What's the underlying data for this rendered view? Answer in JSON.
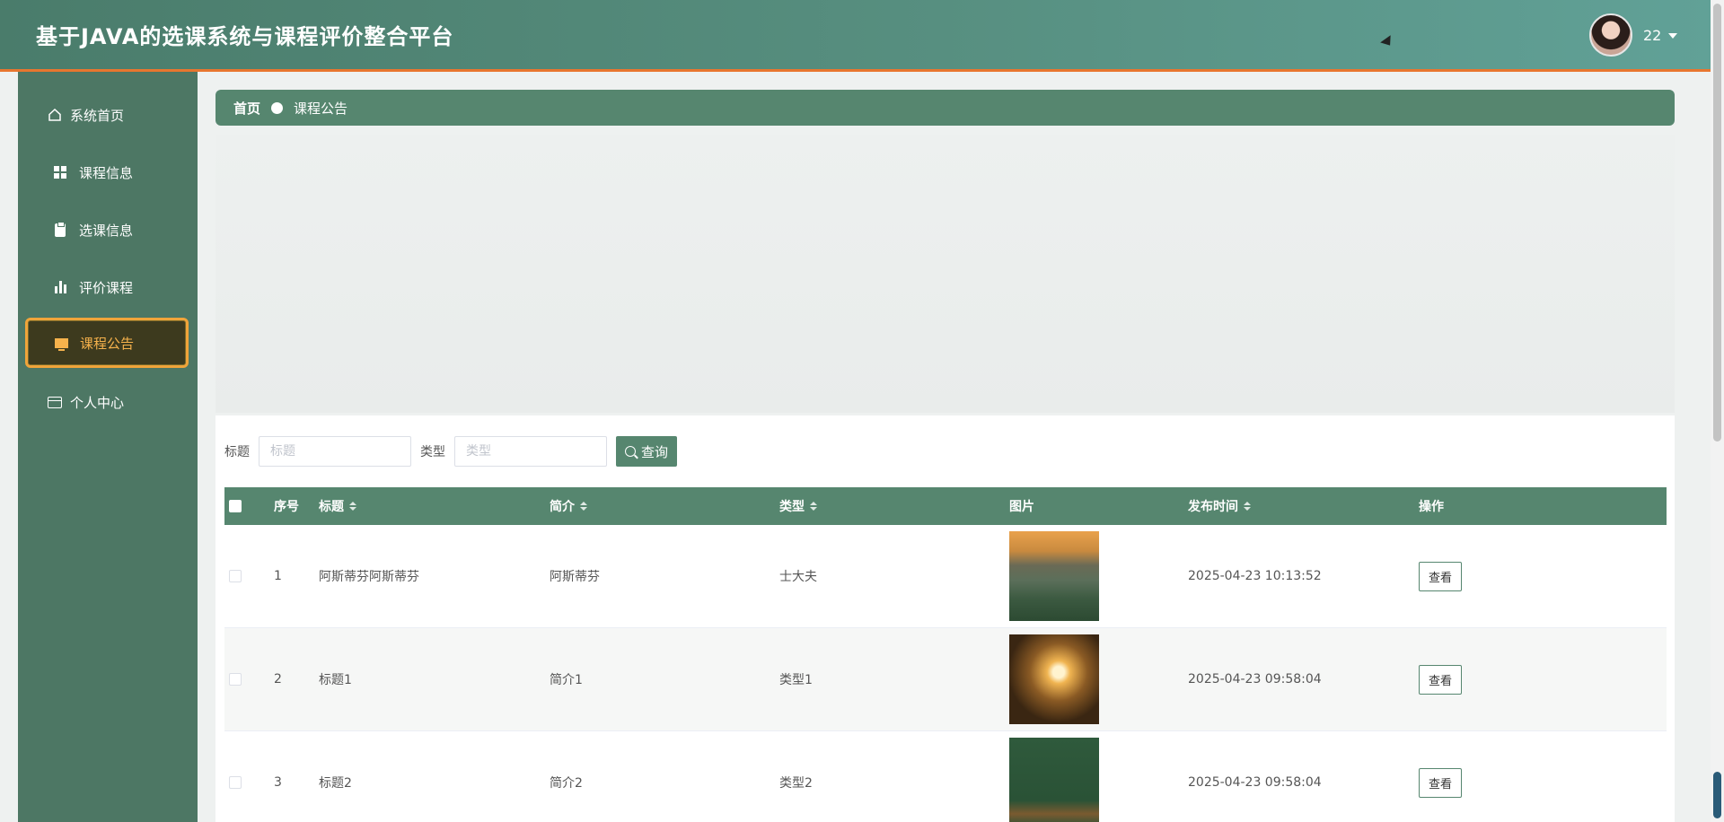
{
  "header": {
    "title": "基于JAVA的选课系统与课程评价整合平台",
    "user_name": "22"
  },
  "sidebar": {
    "items": [
      {
        "label": "系统首页",
        "icon": "home-icon"
      },
      {
        "label": "课程信息",
        "icon": "grid-icon"
      },
      {
        "label": "选课信息",
        "icon": "clipboard-icon"
      },
      {
        "label": "评价课程",
        "icon": "bar-chart-icon"
      },
      {
        "label": "课程公告",
        "icon": "monitor-icon",
        "active": true
      },
      {
        "label": "个人中心",
        "icon": "id-card-icon"
      }
    ]
  },
  "breadcrumb": {
    "home": "首页",
    "current": "课程公告"
  },
  "search": {
    "title_label": "标题",
    "title_placeholder": "标题",
    "type_label": "类型",
    "type_placeholder": "类型",
    "query_button": "查询"
  },
  "table": {
    "headers": {
      "index": "序号",
      "title": "标题",
      "intro": "简介",
      "type": "类型",
      "image": "图片",
      "published": "发布时间",
      "actions": "操作"
    },
    "rows": [
      {
        "index": "1",
        "title": "阿斯蒂芬阿斯蒂芬",
        "intro": "阿斯蒂芬",
        "type": "士大夫",
        "published": "2025-04-23 10:13:52",
        "action": "查看"
      },
      {
        "index": "2",
        "title": "标题1",
        "intro": "简介1",
        "type": "类型1",
        "published": "2025-04-23 09:58:04",
        "action": "查看"
      },
      {
        "index": "3",
        "title": "标题2",
        "intro": "简介2",
        "type": "类型2",
        "published": "2025-04-23 09:58:04",
        "action": "查看"
      }
    ]
  },
  "colors": {
    "primary": "#56866f",
    "sidebar": "#4d7764",
    "accent": "#e8762f",
    "active_text": "#f6b24c"
  }
}
